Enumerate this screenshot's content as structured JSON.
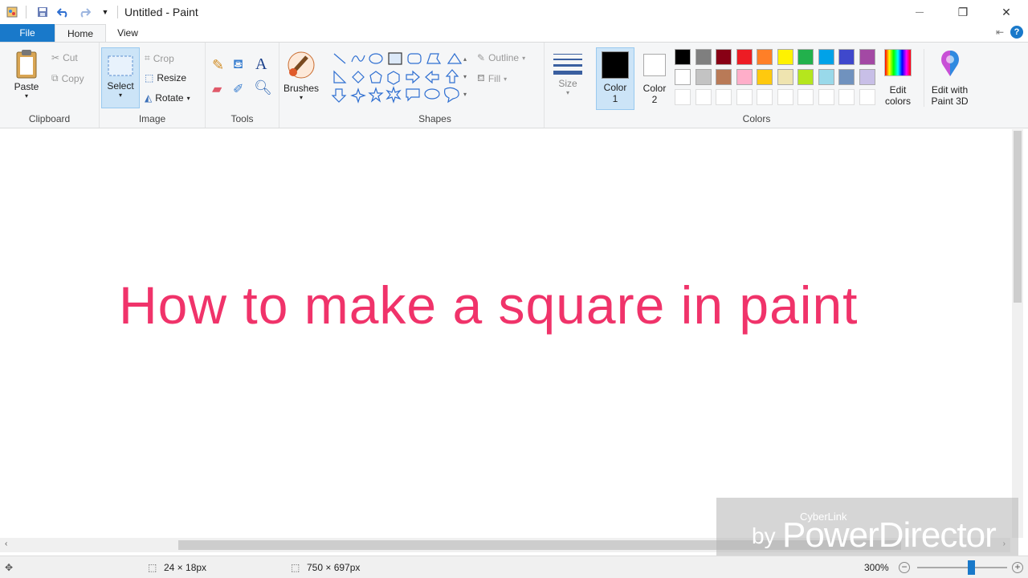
{
  "window": {
    "title": "Untitled - Paint",
    "controls": {
      "minimize": "—",
      "restore": "❐",
      "close": "✕"
    }
  },
  "quick_access": [
    "save-icon",
    "undo-icon",
    "redo-icon",
    "customize-icon"
  ],
  "tabs": {
    "file": "File",
    "home": "Home",
    "view": "View"
  },
  "ribbon": {
    "clipboard": {
      "label": "Clipboard",
      "paste": "Paste",
      "cut": "Cut",
      "copy": "Copy"
    },
    "image": {
      "label": "Image",
      "select": "Select",
      "crop": "Crop",
      "resize": "Resize",
      "rotate": "Rotate"
    },
    "tools": {
      "label": "Tools"
    },
    "brushes": {
      "label": "Brushes"
    },
    "shapes": {
      "label": "Shapes",
      "outline": "Outline",
      "fill": "Fill"
    },
    "size": {
      "label": "Size"
    },
    "color1": {
      "label": "Color",
      "num": "1",
      "value": "#000000"
    },
    "color2": {
      "label": "Color",
      "num": "2",
      "value": "#ffffff"
    },
    "colors": {
      "label": "Colors"
    },
    "edit_colors": {
      "line1": "Edit",
      "line2": "colors"
    },
    "paint3d": {
      "line1": "Edit with",
      "line2": "Paint 3D"
    }
  },
  "palette_row1": [
    "#000000",
    "#7f7f7f",
    "#880015",
    "#ed1c24",
    "#ff7f27",
    "#fff200",
    "#22b14c",
    "#00a2e8",
    "#3f48cc",
    "#a349a4"
  ],
  "palette_row2": [
    "#ffffff",
    "#c3c3c3",
    "#b97a57",
    "#ffaec9",
    "#ffc90e",
    "#efe4b0",
    "#b5e61d",
    "#99d9ea",
    "#7092be",
    "#c8bfe7"
  ],
  "canvas": {
    "headline": "How to make a square in paint"
  },
  "status": {
    "selection_size": "24 × 18px",
    "image_size": "750 × 697px",
    "zoom": "300%"
  },
  "watermark": {
    "brand_small": "CyberLink",
    "by": "by",
    "product": "PowerDirector"
  }
}
